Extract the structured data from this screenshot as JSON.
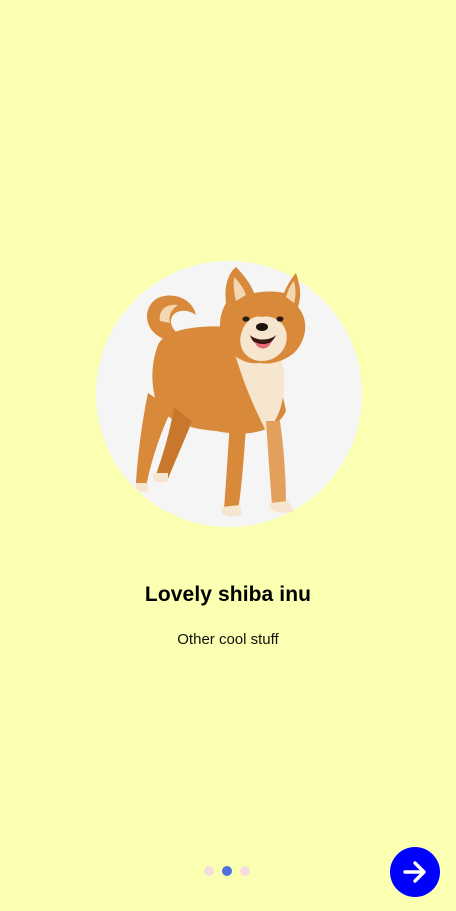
{
  "onboarding": {
    "title": "Lovely shiba inu",
    "subtitle": "Other cool stuff",
    "page_indicator": {
      "count": 3,
      "active_index": 1,
      "active_color": "#4E6FE2",
      "inactive_color": "#F6DCDC"
    },
    "next_button": {
      "icon": "arrow-right-icon",
      "color": "#0000FF"
    },
    "hero_image": {
      "subject": "shiba-inu-dog",
      "background": "#F5F5F5"
    }
  },
  "theme": {
    "background": "#FAFFB1"
  }
}
